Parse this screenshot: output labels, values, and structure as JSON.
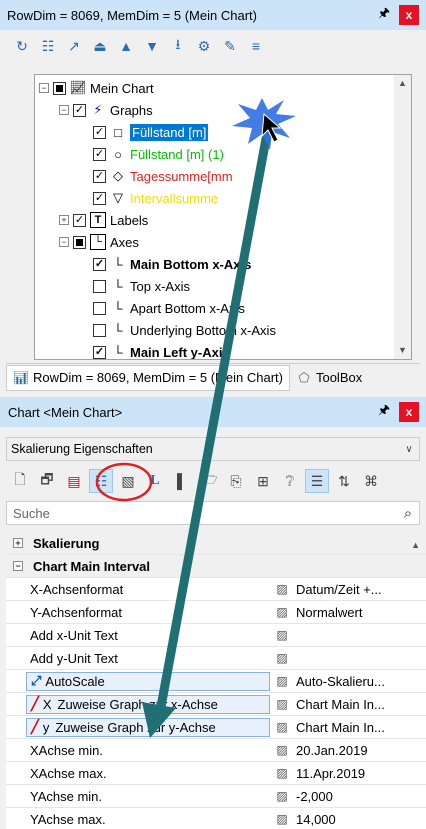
{
  "top_panel": {
    "title": "RowDim = 8069, MemDim = 5 (Mein Chart)",
    "pin_icon": "pin-icon",
    "close_label": "x",
    "toolbar_icons": [
      "refresh-icon",
      "table-icon",
      "chart-icon",
      "move-top-icon",
      "move-up-icon",
      "move-down-icon",
      "move-bottom-icon",
      "settings-icon",
      "rename-icon",
      "edit-icon"
    ],
    "tree": {
      "items": [
        {
          "label": "Mein Chart"
        },
        {
          "label": "Graphs"
        },
        {
          "label": "Füllstand [m]"
        },
        {
          "label": "Füllstand [m] (1)"
        },
        {
          "label": "Tagessumme[mm"
        },
        {
          "label": "Intervallsumme"
        },
        {
          "label": "Labels"
        },
        {
          "label": "Axes"
        },
        {
          "label": "Main Bottom x-Axis"
        },
        {
          "label": "Top x-Axis"
        },
        {
          "label": "Apart Bottom x-Axis"
        },
        {
          "label": "Underlying Bottom x-Axis"
        },
        {
          "label": "Main Left y-Axis"
        }
      ],
      "colors": {
        "green": "#00c000",
        "red": "#e02020",
        "yellow": "#f0e000",
        "selection": "#0078d7"
      }
    },
    "tabs": [
      {
        "label": "RowDim = 8069, MemDim = 5 (Mein Chart)"
      },
      {
        "label": "ToolBox"
      }
    ]
  },
  "bottom_panel": {
    "title": "Chart <Mein Chart>",
    "pin_icon": "pin-icon",
    "close_label": "x",
    "combo_value": "Skalierung Eigenschaften",
    "search_placeholder": "Suche",
    "grid": {
      "categories": [
        {
          "label": "Skalierung",
          "expanded": false
        },
        {
          "label": "Chart Main Interval",
          "expanded": true
        }
      ],
      "rows": [
        {
          "name": "X-Achsenformat",
          "value": "Datum/Zeit +..."
        },
        {
          "name": "Y-Achsenformat",
          "value": "Normalwert"
        },
        {
          "name": "Add x-Unit Text",
          "value": ""
        },
        {
          "name": "Add y-Unit Text",
          "value": ""
        },
        {
          "name": "AutoScale",
          "value": "Auto-Skalieru..."
        },
        {
          "name": "Zuweise Graph zur x-Achse",
          "value": "Chart Main In...",
          "prefix": "X"
        },
        {
          "name": "Zuweise Graph zur y-Achse",
          "value": "Chart Main In...",
          "prefix": "y"
        },
        {
          "name": "XAchse min.",
          "value": "20.Jan.2019"
        },
        {
          "name": "XAchse max.",
          "value": "11.Apr.2019"
        },
        {
          "name": "YAchse min.",
          "value": "-2,000"
        },
        {
          "name": "YAchse max.",
          "value": "14,000"
        }
      ]
    }
  }
}
